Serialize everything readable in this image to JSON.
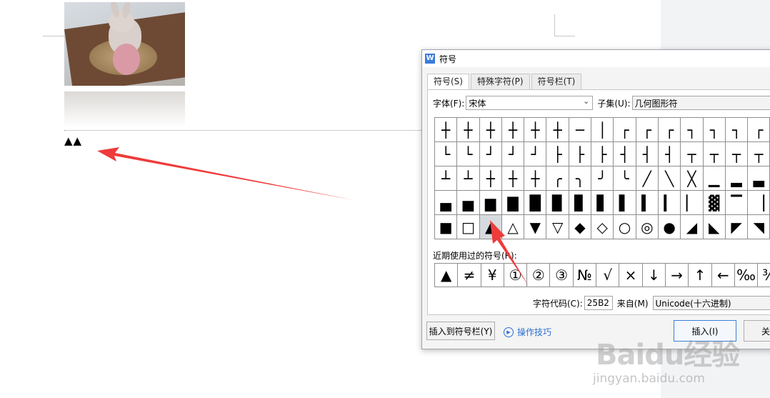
{
  "document": {
    "inserted_text": "▲▲"
  },
  "dialog": {
    "title": "符号",
    "app_icon": "W",
    "tabs": [
      "符号(S)",
      "特殊字符(P)",
      "符号栏(T)"
    ],
    "font_label": "字体(F):",
    "font_value": "宋体",
    "subset_label": "子集(U):",
    "subset_value": "几何图形符",
    "symbols": [
      "┼",
      "┼",
      "┼",
      "┼",
      "┼",
      "┼",
      "─",
      "│",
      "┌",
      "┌",
      "┌",
      "┐",
      "┐",
      "┐",
      "┌",
      "└",
      "└",
      "┘",
      "┘",
      "┘",
      "├",
      "├",
      "├",
      "┤",
      "┤",
      "┤",
      "┬",
      "┬",
      "┬",
      "┬",
      "┴",
      "┴",
      "┼",
      "┼",
      "┼",
      "╭",
      "╮",
      "╯",
      "╰",
      "╱",
      "╲",
      "╳",
      "▁",
      "▂",
      "▃",
      "▄",
      "▅",
      "▆",
      "▇",
      "█",
      "▉",
      "▊",
      "▋",
      "▌",
      "▍",
      "▎",
      "▏",
      "▓",
      "▔",
      "▕",
      "■",
      "□",
      "▲",
      "△",
      "▼",
      "▽",
      "◆",
      "◇",
      "○",
      "◎",
      "●",
      "◢",
      "◣",
      "◤",
      "◥"
    ],
    "selected_index": 62,
    "recent_label": "近期使用过的符号(R):",
    "recent_symbols": [
      "▲",
      "≠",
      "¥",
      "①",
      "②",
      "③",
      "№",
      "√",
      "×",
      "↓",
      "→",
      "↑",
      "←",
      "‰",
      "¾"
    ],
    "char_code_label": "字符代码(C):",
    "char_code_value": "25B2",
    "from_label": "来自(M)",
    "from_value": "Unicode(十六进制)",
    "insert_to_bar_button": "插入到符号栏(Y)",
    "tips_link": "操作技巧",
    "insert_button": "插入(I)",
    "close_button": "关"
  },
  "watermark": {
    "logo": "Baidu经验",
    "url": "jingyan.baidu.com"
  },
  "colors": {
    "annotation_arrow": "#ee3b3b",
    "accent": "#3c7fd6"
  }
}
